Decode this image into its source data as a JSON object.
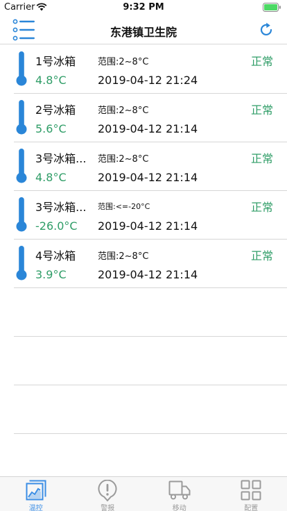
{
  "status_bar": {
    "carrier": "Carrier",
    "time": "9:32 PM"
  },
  "nav": {
    "title": "东港镇卫生院"
  },
  "devices": [
    {
      "name": "1号冰箱",
      "temperature": "4.8°C",
      "range": "范围:2~8°C",
      "time": "2019-04-12 21:24",
      "status": "正常"
    },
    {
      "name": "2号冰箱",
      "temperature": "5.6°C",
      "range": "范围:2~8°C",
      "time": "2019-04-12 21:14",
      "status": "正常"
    },
    {
      "name": "3号冰箱...",
      "temperature": "4.8°C",
      "range": "范围:2~8°C",
      "time": "2019-04-12 21:14",
      "status": "正常"
    },
    {
      "name": "3号冰箱...",
      "temperature": "-26.0°C",
      "range": "范围:<=-20°C",
      "time": "2019-04-12 21:14",
      "status": "正常"
    },
    {
      "name": "4号冰箱",
      "temperature": "3.9°C",
      "range": "范围:2~8°C",
      "time": "2019-04-12 21:14",
      "status": "正常"
    }
  ],
  "tabs": [
    {
      "label": "温控",
      "icon": "chart-icon",
      "active": true
    },
    {
      "label": "警报",
      "icon": "alert-icon",
      "active": false
    },
    {
      "label": "移动",
      "icon": "truck-icon",
      "active": false
    },
    {
      "label": "配置",
      "icon": "grid-icon",
      "active": false
    }
  ],
  "colors": {
    "accent": "#3b8ee5",
    "normal": "#2f9d67",
    "inactive": "#9a9a9a",
    "thermometer": "#2a86d8"
  }
}
